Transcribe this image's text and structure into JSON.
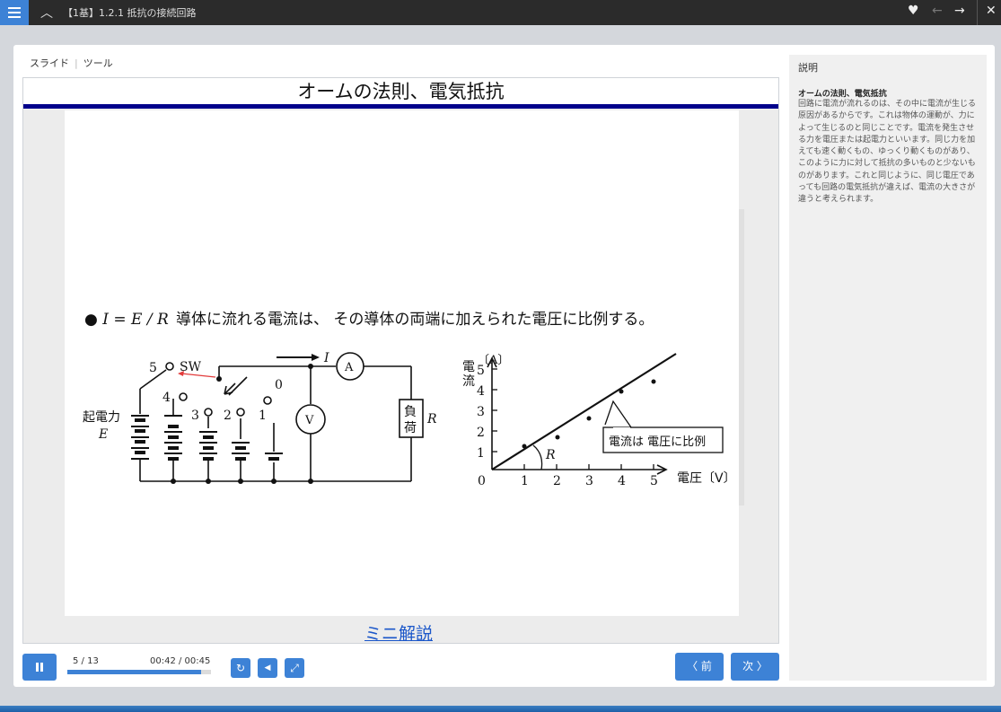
{
  "header": {
    "title": "【1基】1.2.1 抵抗の接続回路",
    "up_icon": "^",
    "icons": [
      "menu-icon",
      "chevron-up-icon",
      "heart-icon",
      "arrow-left-icon",
      "arrow-right-icon",
      "close-icon"
    ]
  },
  "tabs": {
    "slide": "スライド",
    "tool": "ツール"
  },
  "slide": {
    "title": "オームの法則、電気抵抗",
    "formula": "● I = E / R",
    "statement": "導体に流れる電流は、 その導体の両端に加えられた電圧に比例する。",
    "mini_link": "ミニ解説",
    "circuit": {
      "emf_label": "起電力",
      "emf_symbol": "E",
      "switch_label": "SW",
      "switch_positions": [
        "5",
        "4",
        "3",
        "2",
        "1",
        "0"
      ],
      "ammeter": "A",
      "voltmeter": "V",
      "current_symbol": "I",
      "load_label_1": "負",
      "load_label_2": "荷",
      "load_symbol": "R"
    },
    "graph": {
      "y_label_1": "電",
      "y_label_2": "流",
      "y_unit": "〔A〕",
      "x_label": "電圧〔V〕",
      "y_ticks": [
        "1",
        "2",
        "3",
        "4",
        "5"
      ],
      "x_ticks": [
        "1",
        "2",
        "3",
        "4",
        "5"
      ],
      "origin": "0",
      "slope_label": "R",
      "callout": "電流は 電圧に比例"
    }
  },
  "panel": {
    "label": "説明",
    "heading": "オームの法則、電気抵抗",
    "body": "回路に電流が流れるのは、その中に電流が生じる原因があるからです。これは物体の運動が、力によって生じるのと同じことです。電流を発生させる力を電圧または起電力といいます。同じ力を加えても速く動くもの、ゆっくり動くものがあり、このように力に対して抵抗の多いものと少ないものがあります。これと同じように、同じ電圧であっても回路の電気抵抗が違えば、電流の大きさが違うと考えられます。"
  },
  "controls": {
    "counter": "5 / 13",
    "time": "00:42 / 00:45",
    "progress": 0.93,
    "prev": "〈 前",
    "next": "次 〉",
    "replay_icon": "↻",
    "volume_icon": "◀",
    "fullscreen_icon": "⤢"
  },
  "colors": {
    "accent": "#3d82d6",
    "title_rule": "#00008b",
    "link": "#1a56c9"
  }
}
